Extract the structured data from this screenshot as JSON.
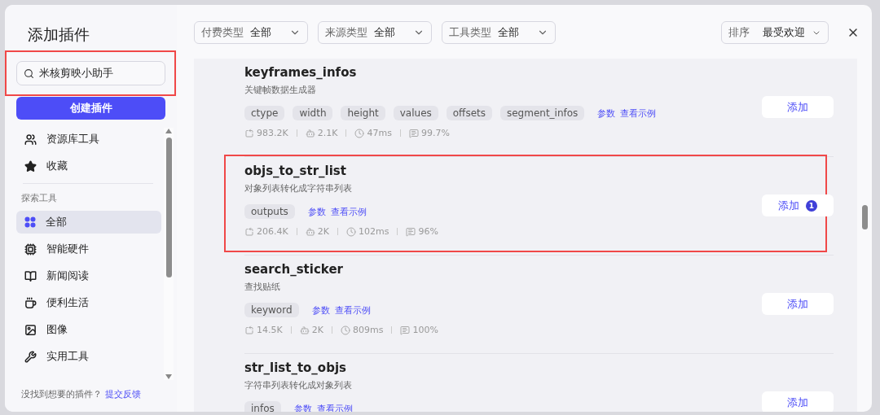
{
  "sidebar": {
    "title": "添加插件",
    "search": {
      "value": "米核剪映小助手",
      "highlighted": true
    },
    "create_button": "创建插件",
    "top_items": [
      {
        "label": "资源库工具",
        "selected": false
      },
      {
        "label": "收藏",
        "selected": false
      }
    ],
    "section_title": "探索工具",
    "items": [
      {
        "label": "全部",
        "selected": true
      },
      {
        "label": "智能硬件",
        "selected": false
      },
      {
        "label": "新闻阅读",
        "selected": false
      },
      {
        "label": "便利生活",
        "selected": false
      },
      {
        "label": "图像",
        "selected": false
      },
      {
        "label": "实用工具",
        "selected": false
      }
    ],
    "footer": {
      "text": "没找到想要的插件？",
      "link": "提交反馈"
    }
  },
  "filters": [
    {
      "label": "付费类型",
      "value": "全部"
    },
    {
      "label": "来源类型",
      "value": "全部"
    },
    {
      "label": "工具类型",
      "value": "全部"
    }
  ],
  "sort": {
    "label": "排序",
    "value": "最受欢迎"
  },
  "plugins": [
    {
      "name": "keyframes_infos",
      "description": "关键帧数据生成器",
      "params": [
        "ctype",
        "width",
        "height",
        "values",
        "offsets",
        "segment_infos"
      ],
      "links": [
        "参数",
        "查看示例"
      ],
      "stats": [
        "983.2K",
        "2.1K",
        "47ms",
        "99.7%"
      ],
      "button": "添加",
      "highlighted": false
    },
    {
      "name": "objs_to_str_list",
      "description": "对象列表转化成字符串列表",
      "params": [
        "outputs"
      ],
      "links": [
        "参数",
        "查看示例"
      ],
      "stats": [
        "206.4K",
        "2K",
        "102ms",
        "96%"
      ],
      "button": "添加",
      "badge": "1",
      "highlighted": true
    },
    {
      "name": "search_sticker",
      "description": "查找贴纸",
      "params": [
        "keyword"
      ],
      "links": [
        "参数",
        "查看示例"
      ],
      "stats": [
        "14.5K",
        "2K",
        "809ms",
        "100%"
      ],
      "button": "添加",
      "highlighted": false
    },
    {
      "name": "str_list_to_objs",
      "description": "字符串列表转化成对象列表",
      "params": [
        "infos"
      ],
      "links": [
        "参数",
        "查看示例"
      ],
      "button": "添加",
      "highlighted": false
    }
  ]
}
